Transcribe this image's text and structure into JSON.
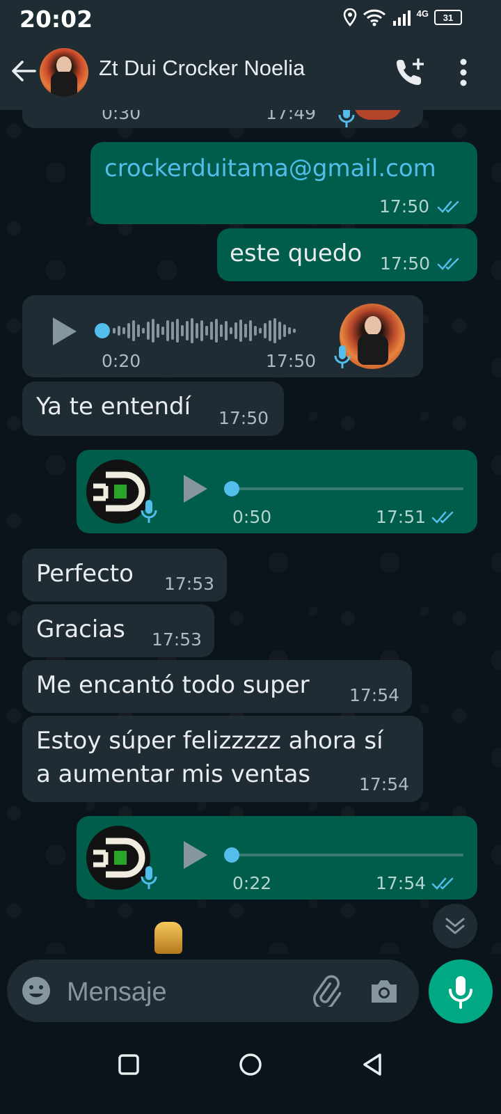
{
  "status_bar": {
    "time": "20:02",
    "network": "4G",
    "battery": "31"
  },
  "header": {
    "title": "Zt Dui Crocker Noelia"
  },
  "messages": [
    {
      "kind": "audio-partial",
      "side": "in",
      "duration": "0:30",
      "time": "17:49"
    },
    {
      "kind": "text",
      "side": "out",
      "text": "crockerduitama@gmail.com",
      "is_link": true,
      "time": "17:50",
      "status": "read"
    },
    {
      "kind": "text",
      "side": "out",
      "text": "este quedo",
      "time": "17:50",
      "status": "read"
    },
    {
      "kind": "audio",
      "side": "in",
      "duration": "0:20",
      "time": "17:50"
    },
    {
      "kind": "text",
      "side": "in",
      "text": "Ya te entendí",
      "time": "17:50"
    },
    {
      "kind": "audio",
      "side": "out",
      "duration": "0:50",
      "time": "17:51",
      "status": "read"
    },
    {
      "kind": "text",
      "side": "in",
      "text": "Perfecto",
      "time": "17:53"
    },
    {
      "kind": "text",
      "side": "in",
      "text": "Gracias",
      "time": "17:53"
    },
    {
      "kind": "text",
      "side": "in",
      "text": "Me encantó todo super",
      "time": "17:54"
    },
    {
      "kind": "text",
      "side": "in",
      "lines": [
        "Estoy súper felizzzzz ahora sí",
        "a aumentar mis ventas"
      ],
      "time": "17:54"
    },
    {
      "kind": "audio",
      "side": "out",
      "duration": "0:22",
      "time": "17:54",
      "status": "read"
    }
  ],
  "composer": {
    "placeholder": "Mensaje"
  },
  "colors": {
    "incoming": "#1f2c34",
    "outgoing": "#005c4b",
    "accent": "#00a884",
    "link": "#53bdeb",
    "read_ticks": "#53bdeb"
  },
  "icons": [
    "back-arrow-icon",
    "add-call-icon",
    "more-vert-icon",
    "play-icon",
    "mic-icon",
    "double-check-icon",
    "emoji-icon",
    "attach-icon",
    "camera-icon",
    "chevron-down-icon",
    "nav-square-icon",
    "nav-circle-icon",
    "nav-back-icon"
  ]
}
